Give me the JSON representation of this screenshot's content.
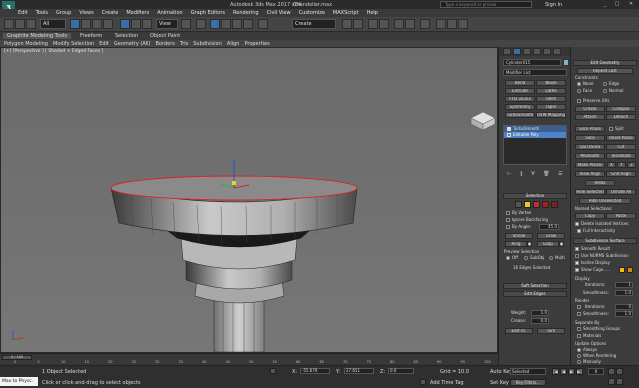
{
  "app": {
    "title": "Autodesk 3ds Max 2017 x64",
    "filename": "Chandelier.max",
    "search_placeholder": "Type a keyword or phrase",
    "sign_in": "Sign In"
  },
  "menu": [
    "Edit",
    "Tools",
    "Group",
    "Views",
    "Create",
    "Modifiers",
    "Animation",
    "Graph Editors",
    "Rendering",
    "Civil View",
    "Customize",
    "MAXScript",
    "Help"
  ],
  "toolbar": {
    "filter": "All",
    "refcoord": "View",
    "named_selection": "Create Selection Se"
  },
  "ribbon": {
    "tabs": [
      "Graphite Modeling Tools",
      "Freeform",
      "Selection",
      "Object Paint"
    ],
    "sub": [
      "Polygon Modeling",
      "Modify Selection",
      "Edit",
      "Geometry (All)",
      "Borders",
      "Tris",
      "Subdivision",
      "Align",
      "Properties"
    ]
  },
  "viewport": {
    "label": "[+] [Perspective ] [ Shaded + Edged Faces ]"
  },
  "cmd": {
    "object_name": "Cylinder015",
    "modifier_list": "Modifier List",
    "mod_buttons": [
      "Bend",
      "Noise",
      "Extrude",
      "Lathe",
      "FFD 3x3x3",
      "Shell",
      "Symmetry",
      "Taper",
      "TurboSmooth",
      "UVW Mapping Cle"
    ],
    "stack": [
      "TurboSmooth",
      "Editable Poly"
    ],
    "selection_header": "Selection",
    "by_vertex": "By Vertex",
    "ignore_backfacing": "Ignore Backfacing",
    "by_angle": "By Angle:",
    "angle_value": "45.0",
    "shrink": "Shrink",
    "grow": "Grow",
    "ring": "Ring",
    "loop": "Loop",
    "preview_selection": "Preview Selection",
    "off": "Off",
    "subobj": "SubObj",
    "multi": "Multi",
    "selected_count": "16 Edges Selected",
    "soft_selection": "Soft Selection",
    "edit_edges": "Edit Edges",
    "insert_vertex": "Insert Vertex",
    "remove": "Remove",
    "split": "Split",
    "extrude": "Extrude",
    "weld": "Weld",
    "chamfer": "Chamfer",
    "target_weld": "Target Weld",
    "bridge": "Bridge",
    "connect": "Connect",
    "create_shape": "Create Shape From Selection",
    "weight_label": "Weight:",
    "weight_value": "1.0",
    "crease_label": "Crease:",
    "crease_value": "0.0",
    "edit_tri": "Edit Tri.",
    "turn": "Turn"
  },
  "editgeo": {
    "header": "Edit Geometry",
    "repeat_last": "Repeat Last",
    "constraints": "Constraints",
    "none": "None",
    "edge": "Edge",
    "face": "Face",
    "normal": "Normal",
    "preserve_uvs": "Preserve UVs",
    "create": "Create",
    "collapse": "Collapse",
    "attach": "Attach",
    "detach": "Detach",
    "slice_plane": "Slice Plane",
    "split": "Split",
    "slice": "Slice",
    "reset_plane": "Reset Plane",
    "quickslice": "QuickSlice",
    "cut": "Cut",
    "msmooth": "MSmooth",
    "tessellate": "Tessellate",
    "make_planar": "Make Planar",
    "x": "X",
    "y": "Y",
    "z": "Z",
    "view_align": "View Align",
    "grid_align": "Grid Align",
    "relax": "Relax",
    "hide_selected": "Hide Selected",
    "unhide_all": "Unhide All",
    "hide_unselected": "Hide Unselected",
    "named_selections": "Named Selections:",
    "copy": "Copy",
    "paste": "Paste",
    "delete_isolated": "Delete Isolated Vertices",
    "full_interactivity": "Full Interactivity",
    "subdiv_header": "Subdivision Surface",
    "smooth_result": "Smooth Result",
    "use_nurms": "Use NURMS Subdivision",
    "isoline": "Isoline Display",
    "show_cage": "Show Cage......",
    "display": "Display",
    "iterations_label": "Iterations:",
    "iterations_value": "1",
    "smoothness_label": "Smoothness:",
    "smoothness_value": "1.0",
    "render": "Render",
    "r_iterations_value": "0",
    "r_smoothness_value": "1.0",
    "separate_by": "Separate By",
    "smoothing_groups": "Smoothing Groups",
    "materials": "Materials",
    "update_options": "Update Options",
    "always": "Always",
    "when_rendering": "When Rendering",
    "manually": "Manually",
    "cage_color1": "#f0c000",
    "cage_color2": "#e08000"
  },
  "timeline": {
    "frame": "0 / 100",
    "ticks": [
      "0",
      "5",
      "10",
      "15",
      "20",
      "25",
      "30",
      "35",
      "40",
      "45",
      "50",
      "55",
      "60",
      "65",
      "70",
      "75",
      "80",
      "85",
      "90",
      "95",
      "100"
    ]
  },
  "status": {
    "maxscript": "Max to Physc.",
    "selected": "1 Object Selected",
    "hint": "Click or click-and-drag to select objects",
    "x": "-55.679",
    "y": "27.651",
    "z": "0.0",
    "grid": "Grid = 10.0",
    "add_time_tag": "Add Time Tag",
    "autokey": "Auto Key",
    "setkey": "Set Key",
    "selected_dd": "Selected",
    "key_filters": "Key Filters...",
    "frame_field": "0"
  }
}
